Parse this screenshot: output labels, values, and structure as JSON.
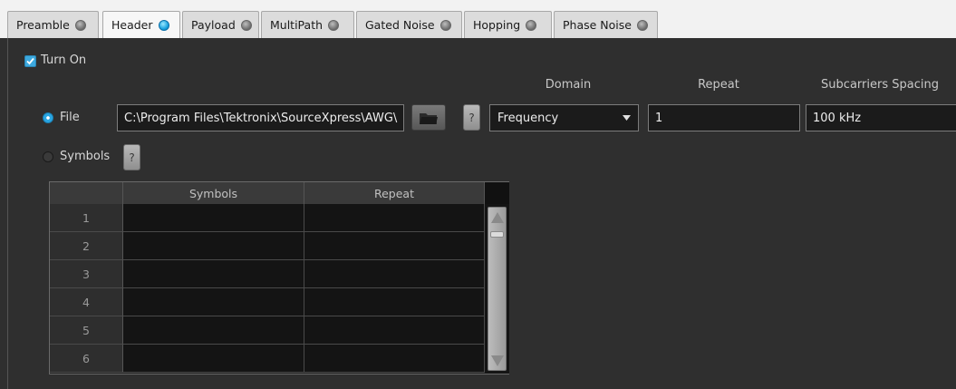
{
  "tabs": [
    {
      "label": "Preamble",
      "active": false
    },
    {
      "label": "Header",
      "active": true
    },
    {
      "label": "Payload",
      "active": false
    },
    {
      "label": "MultiPath",
      "active": false
    },
    {
      "label": "Gated Noise",
      "active": false
    },
    {
      "label": "Hopping",
      "active": false
    },
    {
      "label": "Phase Noise",
      "active": false
    }
  ],
  "turn_on": {
    "label": "Turn On",
    "checked": true
  },
  "columns": {
    "domain": "Domain",
    "repeat": "Repeat",
    "subcarriers": "Subcarriers Spacing"
  },
  "file": {
    "label": "File",
    "selected": true,
    "path": "C:\\Program Files\\Tektronix\\SourceXpress\\AWG\\",
    "help": "?"
  },
  "symbols": {
    "label": "Symbols",
    "selected": false,
    "help": "?"
  },
  "domain": {
    "value": "Frequency"
  },
  "repeat": {
    "value": "1"
  },
  "subcarriers_spacing": {
    "value": "100 kHz"
  },
  "table": {
    "headers": [
      "Symbols",
      "Repeat"
    ],
    "rows": [
      "1",
      "2",
      "3",
      "4",
      "5",
      "6"
    ]
  },
  "colors": {
    "accent": "#2aa6e2",
    "panel": "#2f2f2f",
    "tabbar": "#f2f2f2"
  }
}
